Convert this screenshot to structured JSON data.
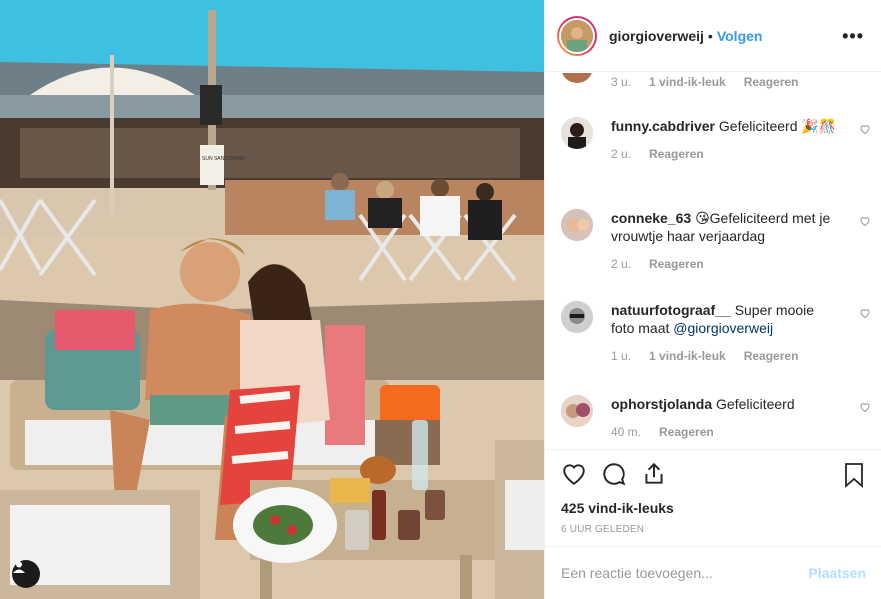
{
  "post": {
    "username": "giorgioverweij",
    "dot": "•",
    "follow_label": "Volgen",
    "more_label": "•••"
  },
  "comments": [
    {
      "user": "",
      "text": "",
      "time": "3 u.",
      "likes": "1 vind-ik-leuk",
      "reply": "Reageren"
    },
    {
      "user": "funny.cabdriver",
      "text": "Gefeliciteerd 🎉🎊",
      "time": "2 u.",
      "likes": "",
      "reply": "Reageren"
    },
    {
      "user": "conneke_63",
      "text": "😘Gefeliciteerd met je vrouwtje haar verjaardag",
      "time": "2 u.",
      "likes": "",
      "reply": "Reageren"
    },
    {
      "user": "natuurfotograaf__",
      "text": "Super mooie foto maat ",
      "mention": "@giorgioverweij",
      "time": "1 u.",
      "likes": "1 vind-ik-leuk",
      "reply": "Reageren"
    },
    {
      "user": "ophorstjolanda",
      "text": "Gefeliciteerd",
      "time": "40 m.",
      "likes": "",
      "reply": "Reageren"
    }
  ],
  "actions": {
    "like_count": "425 vind-ik-leuks",
    "posted": "6 UUR GELEDEN"
  },
  "add_comment": {
    "placeholder": "Een reactie toevoegen...",
    "post_label": "Plaatsen"
  },
  "photo": {
    "sign_text": "SUN SAND DRINK"
  },
  "colors": {
    "link": "#3897f0",
    "post_disabled": "#b2dffc",
    "muted": "#999999"
  }
}
